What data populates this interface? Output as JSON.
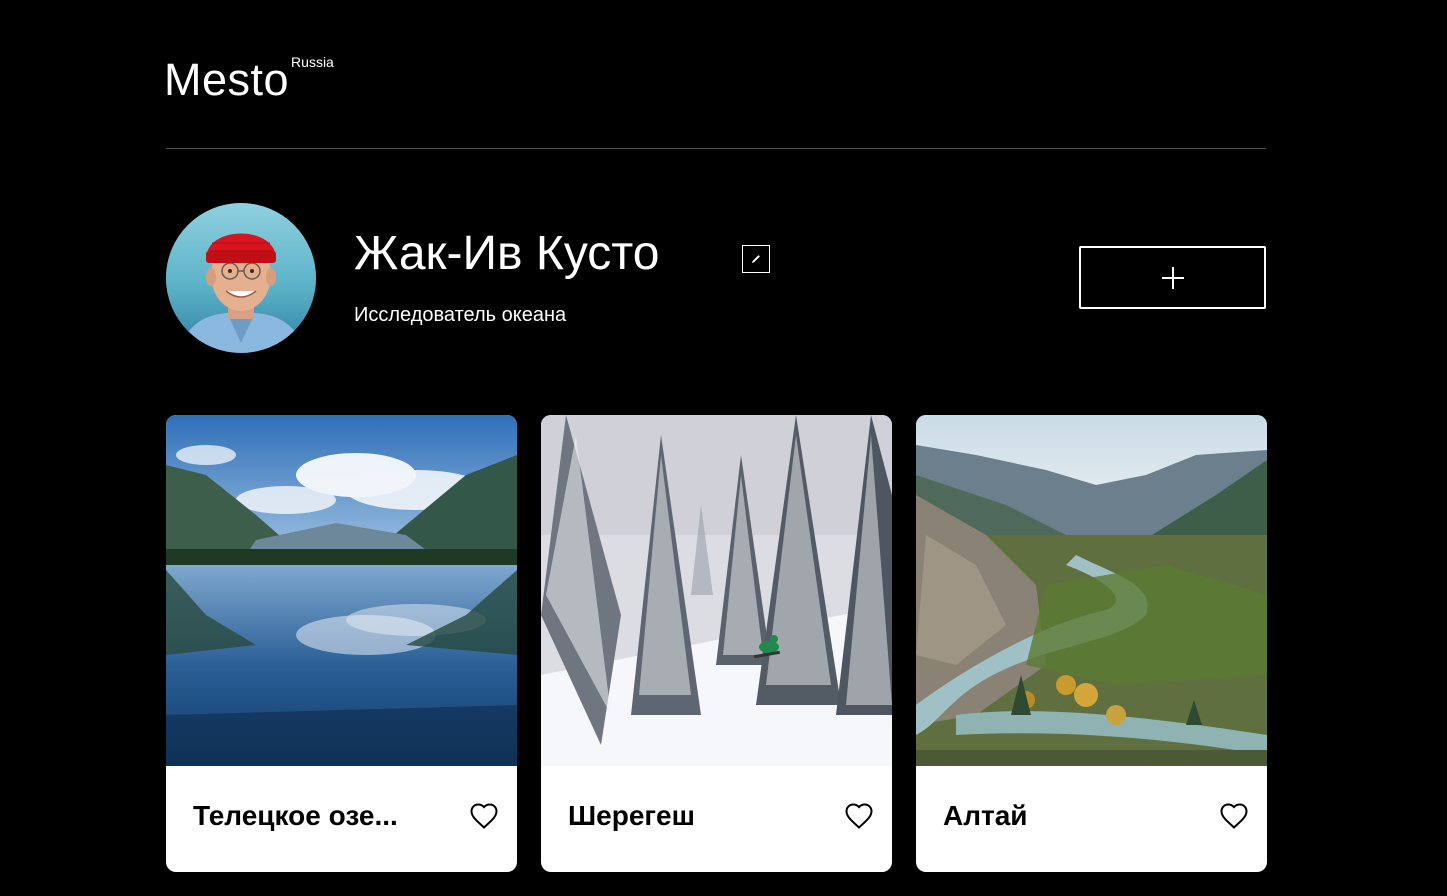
{
  "header": {
    "logo": "Mesto",
    "logo_sup": "Russia"
  },
  "profile": {
    "name": "Жак-Ив Кусто",
    "about": "Исследователь океана",
    "edit_icon": "pencil-icon",
    "add_icon": "plus-icon"
  },
  "cards": [
    {
      "title": "Телецкое озе...",
      "like_icon": "heart-outline-icon",
      "photo": "mountain lake reflection"
    },
    {
      "title": "Шерегеш",
      "like_icon": "heart-outline-icon",
      "photo": "snowy forest with snowboarder"
    },
    {
      "title": "Алтай",
      "like_icon": "heart-outline-icon",
      "photo": "mountain valley with river"
    }
  ],
  "colors": {
    "background": "#000000",
    "card": "#ffffff",
    "divider": "#545454",
    "text": "#ffffff",
    "card_text": "#000000"
  }
}
